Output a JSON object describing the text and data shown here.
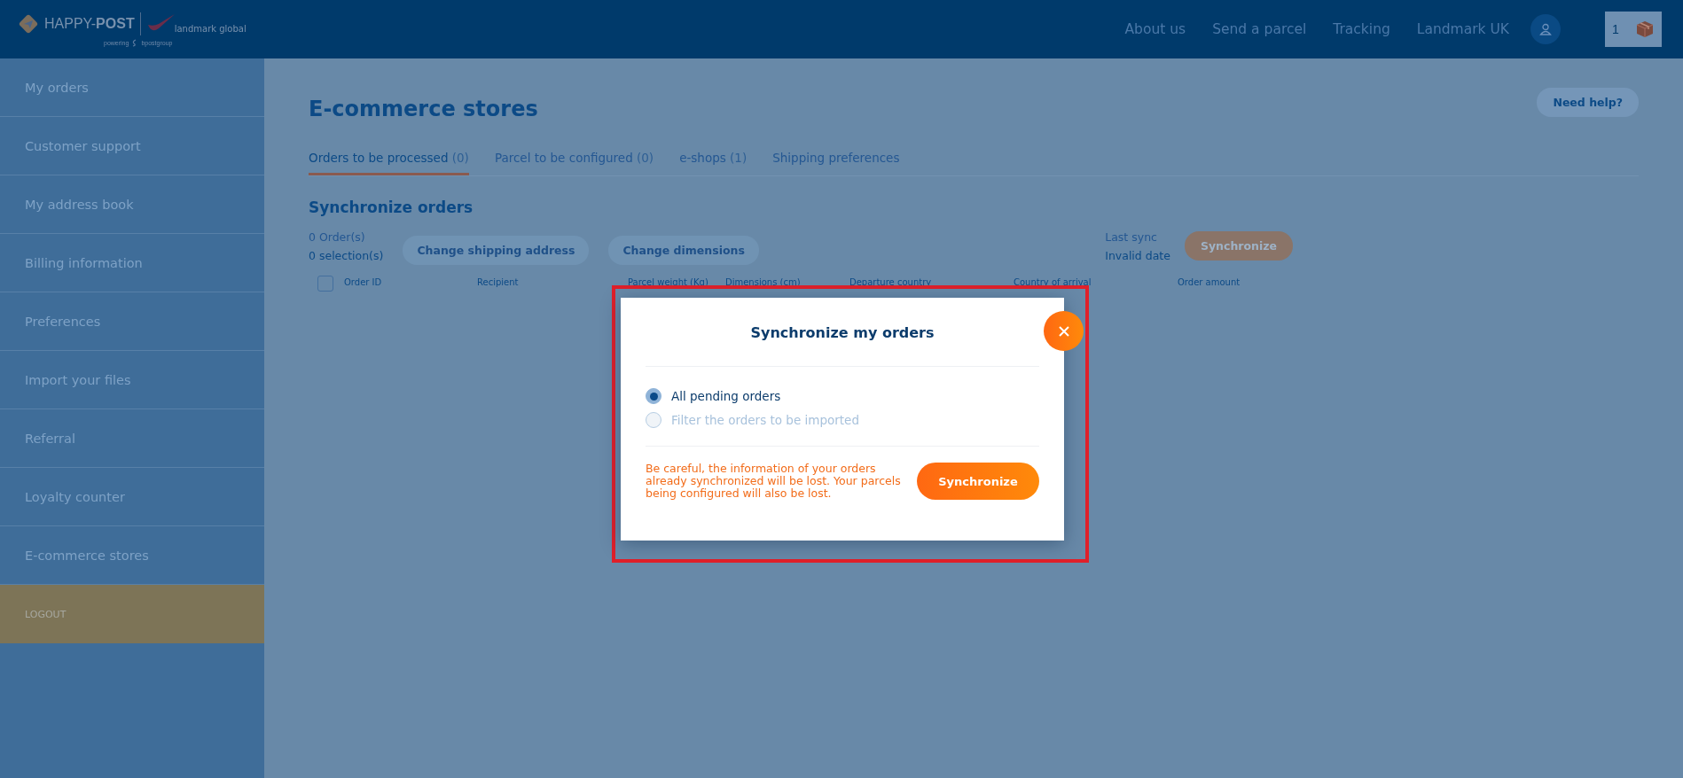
{
  "header": {
    "logo": {
      "brand": "HAPPY-**POST**",
      "partner": "landmark global",
      "tagline_prefix": "powering",
      "tagline_group": "bpostgroup"
    },
    "nav": [
      {
        "label": "About us"
      },
      {
        "label": "Send a parcel"
      },
      {
        "label": "Tracking"
      },
      {
        "label": "Landmark UK"
      }
    ],
    "cart": {
      "count": "1"
    }
  },
  "sidebar": {
    "items": [
      {
        "label": "My orders",
        "kind": "link"
      },
      {
        "label": "Customer support",
        "kind": "link"
      },
      {
        "label": "My address book",
        "kind": "link"
      },
      {
        "label": "Billing information",
        "kind": "link"
      },
      {
        "label": "Preferences",
        "kind": "link"
      },
      {
        "label": "Import your files",
        "kind": "link"
      },
      {
        "label": "Referral",
        "kind": "link"
      },
      {
        "label": "Loyalty counter",
        "kind": "link"
      },
      {
        "label": "E-commerce stores",
        "kind": "link"
      },
      {
        "label": "LOGOUT",
        "kind": "logout"
      }
    ]
  },
  "page": {
    "title": "E-commerce stores",
    "help_button": "Need help?",
    "tabs": [
      {
        "label": "Orders to be processed",
        "count": "(0)",
        "selected": true
      },
      {
        "label": "Parcel to be configured",
        "count": "(0)",
        "selected": false
      },
      {
        "label": "e-shops",
        "count": "(1)",
        "selected": false
      },
      {
        "label": "Shipping preferences",
        "selected": false
      }
    ],
    "section_title": "Synchronize orders",
    "order_count": "0 Order(s)",
    "selection_count": "0 selection(s)",
    "actions": [
      "Change shipping address",
      "Change dimensions"
    ],
    "last_sync_label": "Last sync",
    "last_sync_value": "Invalid date",
    "sync_button": "Synchronize",
    "table": {
      "select_all_checked": false,
      "columns": [
        "Order ID",
        "Recipient",
        "Parcel weight (Kg)",
        "Dimensions (cm)",
        "Departure country",
        "Country of arrival",
        "Order amount"
      ]
    }
  },
  "modal": {
    "title": "Synchronize my orders",
    "options": [
      {
        "label": "All pending orders",
        "selected": true
      },
      {
        "label": "Filter the orders to be imported",
        "selected": false
      }
    ],
    "warning": "Be careful, the information of your orders already synchronized will be lost. Your parcels being configured will also be lost.",
    "button": "Synchronize"
  }
}
